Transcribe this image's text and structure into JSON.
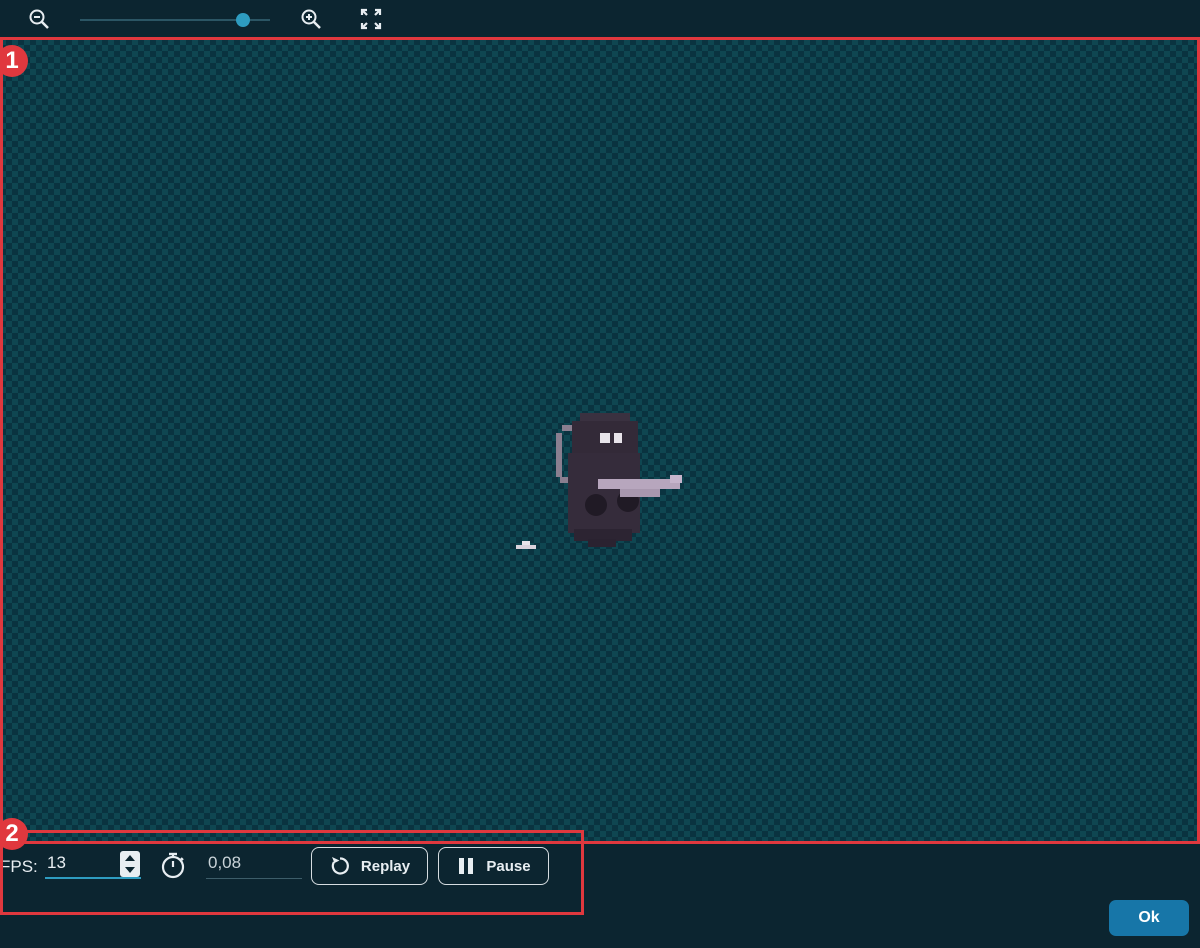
{
  "toolbar": {
    "zoom_out_icon": "zoom-out-icon",
    "zoom_in_icon": "zoom-in-icon",
    "fit_icon": "expand-arrows-icon",
    "zoom_level_fraction": 0.86
  },
  "annotations": {
    "preview_badge": "1",
    "controls_badge": "2",
    "color": "#e0383e"
  },
  "controls": {
    "fps_label": "FPS:",
    "fps_value": "13",
    "timer_icon": "stopwatch-icon",
    "frame_duration": "0,08",
    "replay_label": "Replay",
    "replay_icon": "replay-icon",
    "pause_label": "Pause",
    "pause_icon": "pause-icon"
  },
  "dialog": {
    "ok_label": "Ok"
  },
  "colors": {
    "background": "#0c2530",
    "accent": "#2e9cc0",
    "ok_button": "#1776a8"
  }
}
